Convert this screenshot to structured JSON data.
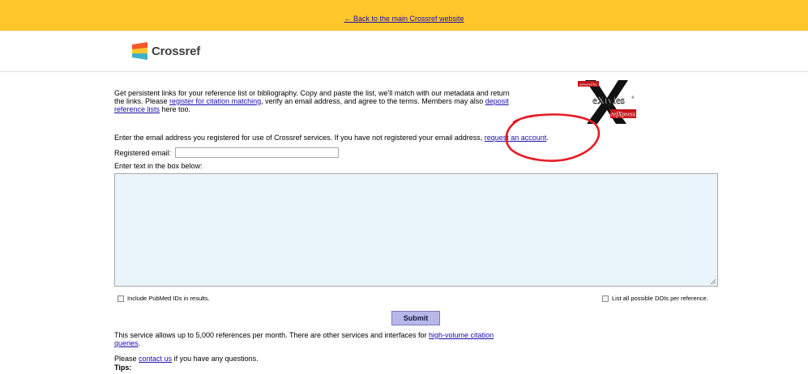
{
  "topbar": {
    "back_link": "← Back to the main Crossref website",
    "color": "#ffc72c"
  },
  "brand": {
    "name": "Crossref",
    "logo_colors": [
      "#f15a22",
      "#ffc72c",
      "#3eb1c8"
    ]
  },
  "intro": {
    "text1": "Get persistent links for your reference list or bibliography. Copy and paste the list, we'll match with our metadata and return the links. Please ",
    "link1": "register for citation matching",
    "text2": ", verify an email address, and agree to the terms. Members may also ",
    "link2": "deposit reference lists",
    "text3": " here too."
  },
  "badge": {
    "powered_by": "powered by",
    "brand": "eXtyles",
    "product": "refXpress",
    "mark": "®"
  },
  "email_notice": {
    "text": "Enter the email address you registered for use of Crossref services. If you have not registered your email address, ",
    "link": "request an account",
    "suffix": "."
  },
  "form": {
    "email_label": "Registered email:",
    "email_value": "",
    "text_label": "Enter text in the box below:",
    "text_value": "",
    "pubmed_label": "Include PubMed IDs in results.",
    "all_dois_label": "List all possible DOIs per reference.",
    "submit_label": "Submit"
  },
  "service": {
    "text": "This service allows up to 5,000 references per month. There are other services and interfaces for ",
    "link": "high-volume citation queries",
    "suffix": "."
  },
  "contact": {
    "prefix": "Please ",
    "link": "contact us",
    "suffix": " if you have any questions."
  },
  "tips": "Tips:",
  "annotation": {
    "color": "#e41b23"
  }
}
